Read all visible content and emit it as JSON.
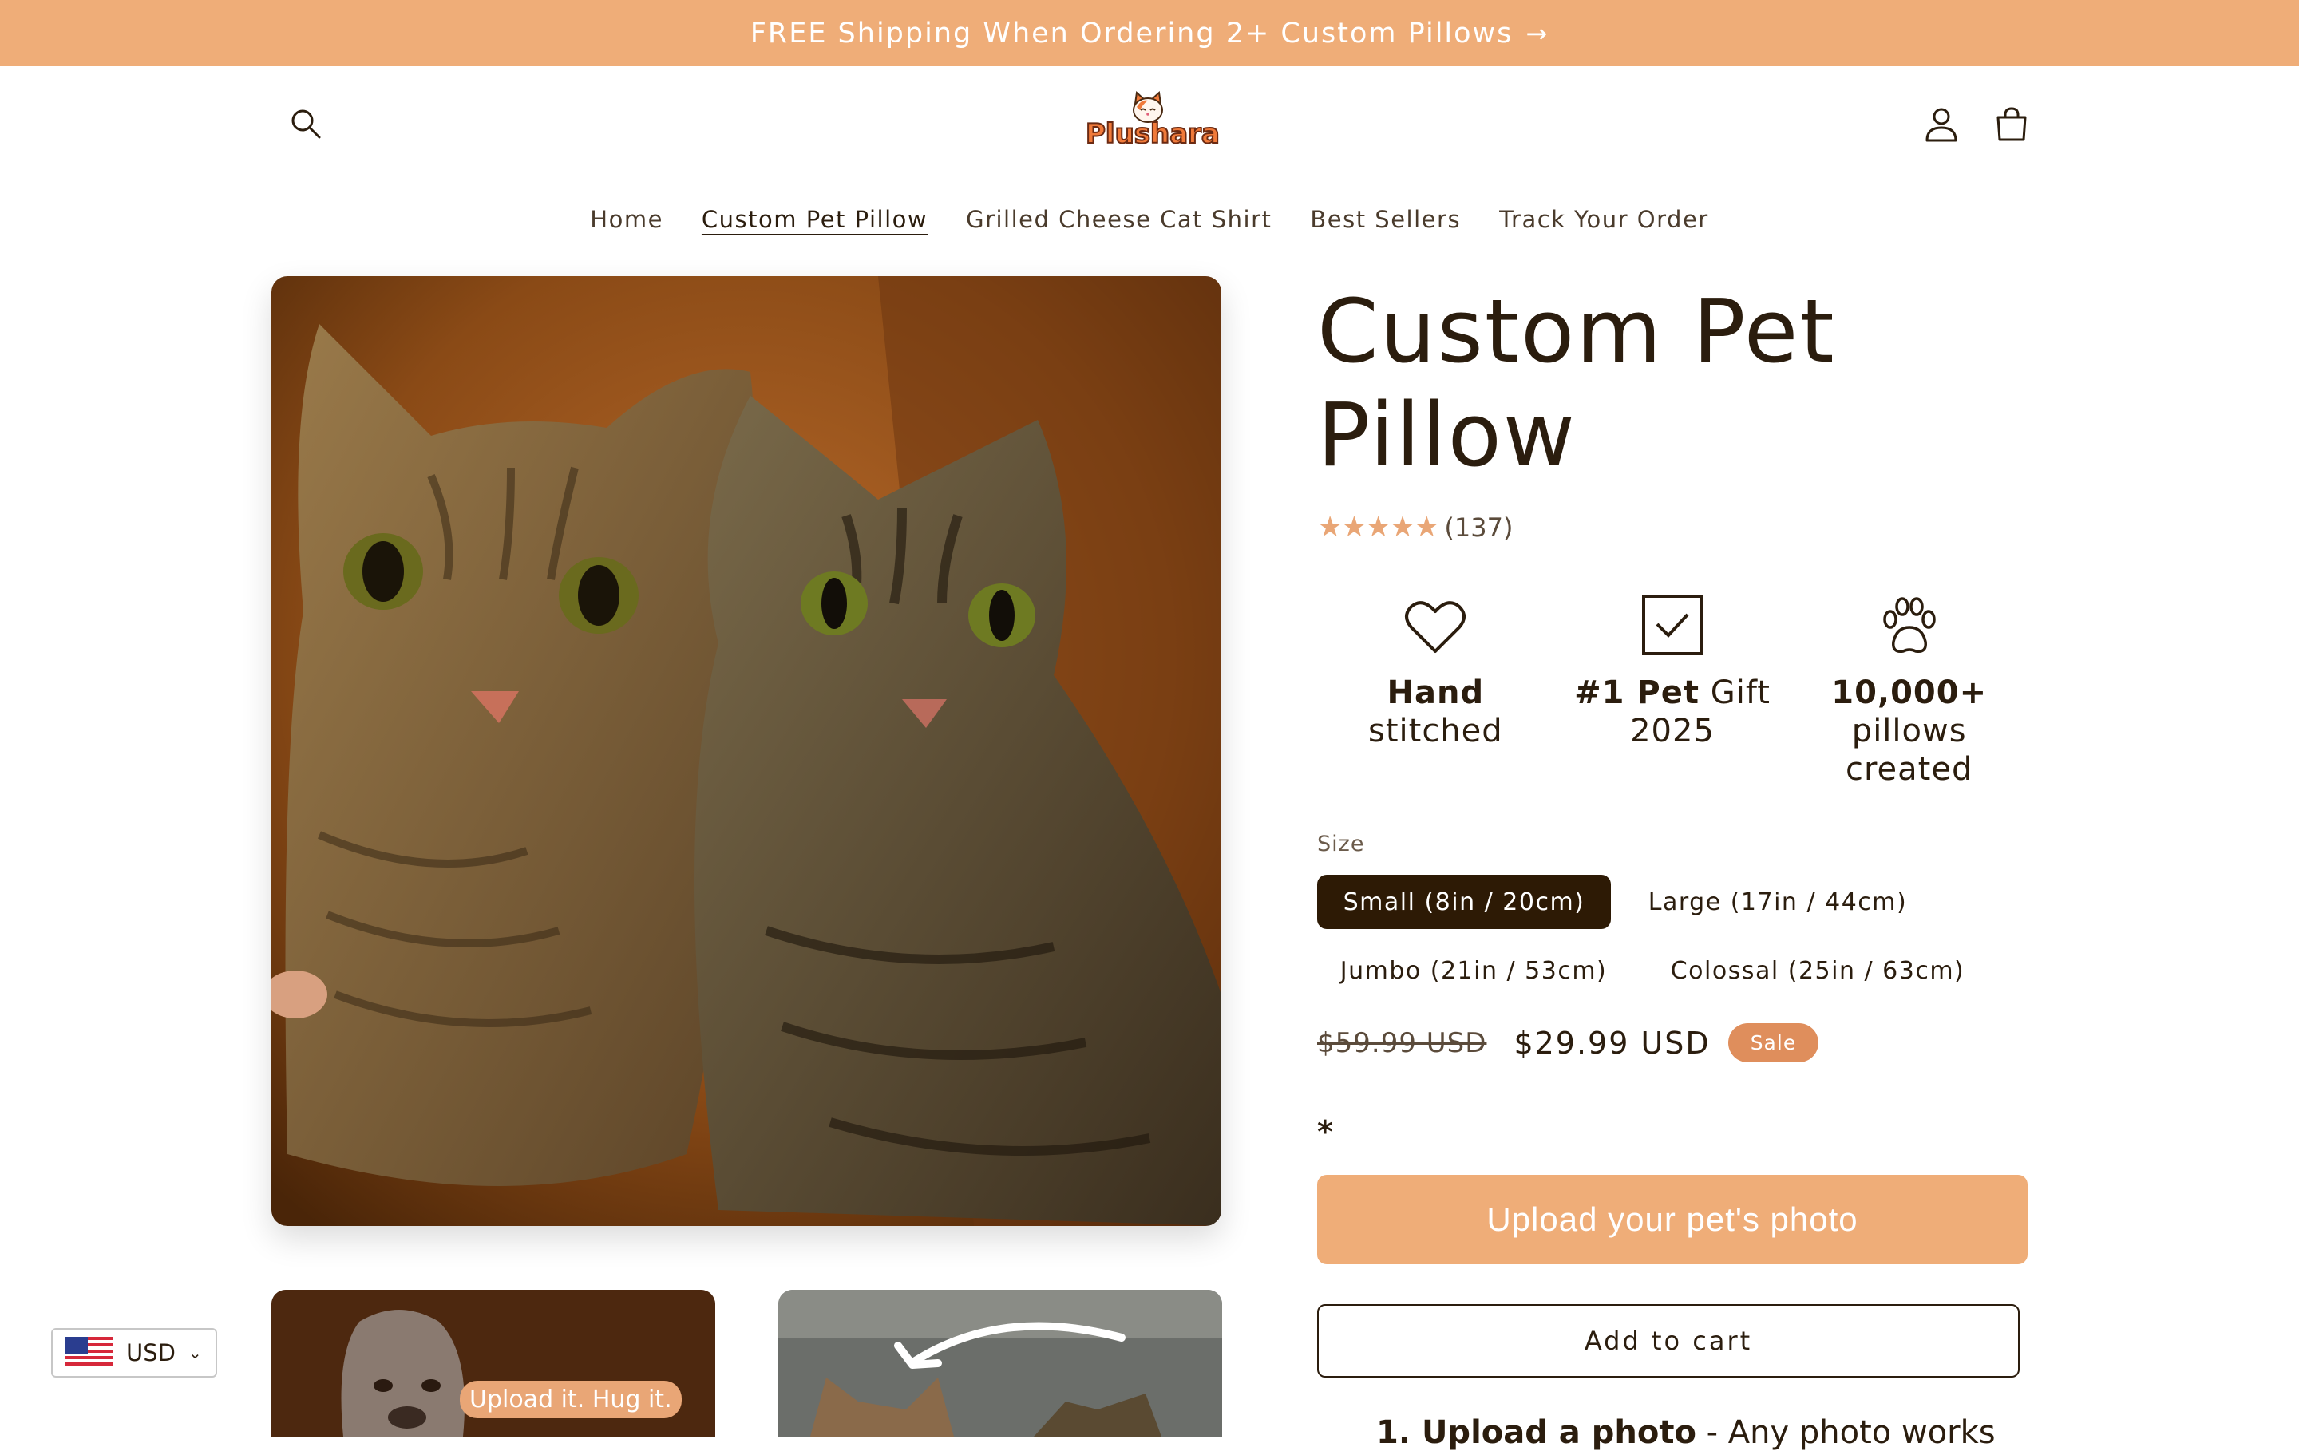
{
  "announcement": {
    "text": "FREE Shipping When Ordering 2+ Custom Pillows",
    "arrow": "→"
  },
  "header": {
    "logo_text": "Plushara"
  },
  "nav": {
    "items": [
      {
        "label": "Home"
      },
      {
        "label": "Custom Pet Pillow"
      },
      {
        "label": "Grilled Cheese Cat Shirt"
      },
      {
        "label": "Best Sellers"
      },
      {
        "label": "Track Your Order"
      }
    ]
  },
  "gallery": {
    "thumb_badge": "Upload it. Hug it."
  },
  "product": {
    "title": "Custom Pet Pillow",
    "rating": {
      "stars": "★★★★★",
      "count": "(137)",
      "value": 5
    },
    "features": [
      {
        "icon": "heart-icon",
        "bold": "Hand",
        "rest": "stitched"
      },
      {
        "icon": "checkbox-icon",
        "bold": "#1 Pet",
        "rest_inline": "Gift",
        "rest": "2025"
      },
      {
        "icon": "paw-icon",
        "bold": "10,000+",
        "rest": "pillows",
        "rest2": "created"
      }
    ],
    "size": {
      "label": "Size",
      "options": [
        {
          "label": "Small (8in / 20cm)",
          "selected": true
        },
        {
          "label": "Large (17in / 44cm)",
          "selected": false
        },
        {
          "label": "Jumbo (21in / 53cm)",
          "selected": false
        },
        {
          "label": "Colossal (25in / 63cm)",
          "selected": false
        }
      ]
    },
    "price": {
      "old": "$59.99 USD",
      "new": "$29.99 USD",
      "badge": "Sale"
    },
    "required_marker": "*",
    "upload_button": "Upload your pet's photo",
    "add_to_cart": "Add to cart",
    "step": {
      "bold": "1. Upload a photo",
      "rest": "- Any photo works"
    }
  },
  "currency": {
    "code": "USD"
  },
  "colors": {
    "accent": "#efad78",
    "dark": "#2d1a05",
    "sale": "#df8e5c",
    "text": "#2b1d0e"
  }
}
